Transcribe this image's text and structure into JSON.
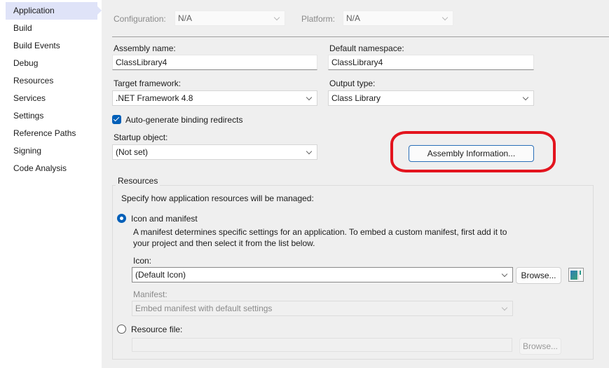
{
  "sidebar": {
    "items": [
      {
        "label": "Application",
        "active": true
      },
      {
        "label": "Build"
      },
      {
        "label": "Build Events"
      },
      {
        "label": "Debug"
      },
      {
        "label": "Resources"
      },
      {
        "label": "Services"
      },
      {
        "label": "Settings"
      },
      {
        "label": "Reference Paths"
      },
      {
        "label": "Signing"
      },
      {
        "label": "Code Analysis"
      }
    ]
  },
  "topbar": {
    "configuration_label": "Configuration:",
    "configuration_value": "N/A",
    "platform_label": "Platform:",
    "platform_value": "N/A"
  },
  "form": {
    "assembly_name_label": "Assembly name:",
    "assembly_name_value": "ClassLibrary4",
    "default_namespace_label": "Default namespace:",
    "default_namespace_value": "ClassLibrary4",
    "target_framework_label": "Target framework:",
    "target_framework_value": ".NET Framework 4.8",
    "output_type_label": "Output type:",
    "output_type_value": "Class Library",
    "auto_binding_label": "Auto-generate binding redirects",
    "auto_binding_checked": true,
    "startup_object_label": "Startup object:",
    "startup_object_value": "(Not set)",
    "assembly_info_button": "Assembly Information..."
  },
  "resources": {
    "group_title": "Resources",
    "intro": "Specify how application resources will be managed:",
    "icon_manifest_label": "Icon and manifest",
    "icon_manifest_selected": true,
    "description": "A manifest determines specific settings for an application. To embed a custom manifest, first add it to your project and then select it from the list below.",
    "icon_label": "Icon:",
    "icon_value": "(Default Icon)",
    "browse_label": "Browse...",
    "manifest_label": "Manifest:",
    "manifest_value": "Embed manifest with default settings",
    "resource_file_label": "Resource file:",
    "resource_file_selected": false,
    "resource_file_value": "",
    "resource_browse_label": "Browse..."
  },
  "colors": {
    "accent": "#005fb8",
    "highlight_ring": "#e3141e",
    "active_nav": "#dfe3f8"
  }
}
